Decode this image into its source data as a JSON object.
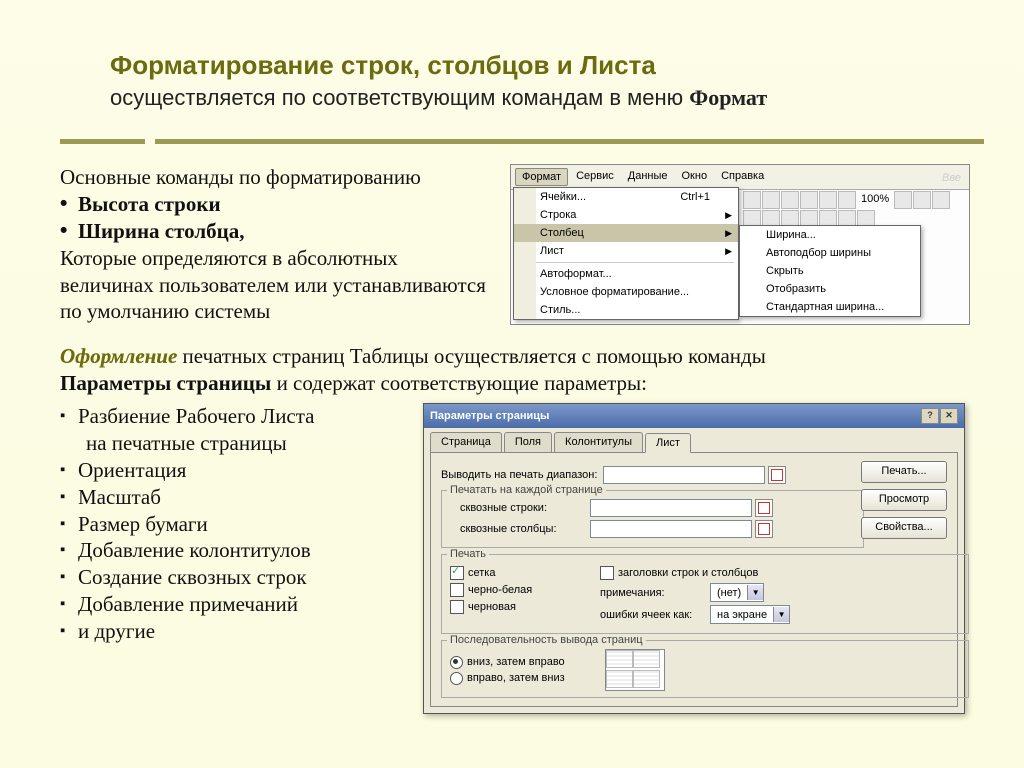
{
  "title": "Форматирование строк, столбцов и Листа",
  "subtitleText": "осуществляется   по соответствующим командам в меню ",
  "wordFormat": "Формат",
  "mainCommands": "Основные команды по форматированию",
  "bullet1": "Высота строки",
  "bullet2": "Ширина столбца,",
  "afterBul": "Которые определяются в абсолютных величинах пользователем или устанавливаются по умолчанию системы",
  "oformlenie": "Оформление",
  "oformText": "печатных страниц Таблицы осуществляется с помощью команды ",
  "pageParams": "Параметры страницы",
  "oformTail": " и содержат соответствующие параметры:",
  "params": {
    "p1a": "Разбиение Рабочего Листа",
    "p1b": "на печатные страницы",
    "p2": "Ориентация",
    "p3": "Масштаб",
    "p4": "Размер бумаги",
    "p5": "Добавление колонтитулов",
    "p6": "Создание сквозных строк",
    "p7": "Добавление примечаний",
    "p8": "и другие"
  },
  "menu": {
    "bar": {
      "m1": "Формат",
      "m2": "Сервис",
      "m3": "Данные",
      "m4": "Окно",
      "m5": "Справка"
    },
    "vve": "Вве",
    "zoom": "100%",
    "items": {
      "cells": "Ячейки...",
      "cellsShort": "Ctrl+1",
      "row": "Строка",
      "col": "Столбец",
      "sheet": "Лист",
      "autoformat": "Автоформат...",
      "cond": "Условное форматирование...",
      "style": "Стиль..."
    },
    "sub": {
      "width": "Ширина...",
      "autofit": "Автоподбор ширины",
      "hide": "Скрыть",
      "show": "Отобразить",
      "stdwidth": "Стандартная ширина..."
    }
  },
  "dlg": {
    "title": "Параметры страницы",
    "tabs": {
      "t1": "Страница",
      "t2": "Поля",
      "t3": "Колонтитулы",
      "t4": "Лист"
    },
    "printRange": "Выводить на печать диапазон:",
    "eachPage": "Печатать на каждой странице",
    "throughRows": "сквозные строки:",
    "throughCols": "сквозные столбцы:",
    "print": "Печать",
    "grid": "сетка",
    "bw": "черно-белая",
    "draft": "черновая",
    "headers": "заголовки строк и столбцов",
    "notes": "примечания:",
    "notesVal": "(нет)",
    "errors": "ошибки ячеек как:",
    "errorsVal": "на экране",
    "order": "Последовательность вывода страниц",
    "orderDown": "вниз, затем вправо",
    "orderRight": "вправо, затем вниз",
    "btnPrint": "Печать...",
    "btnPreview": "Просмотр",
    "btnProps": "Свойства..."
  }
}
